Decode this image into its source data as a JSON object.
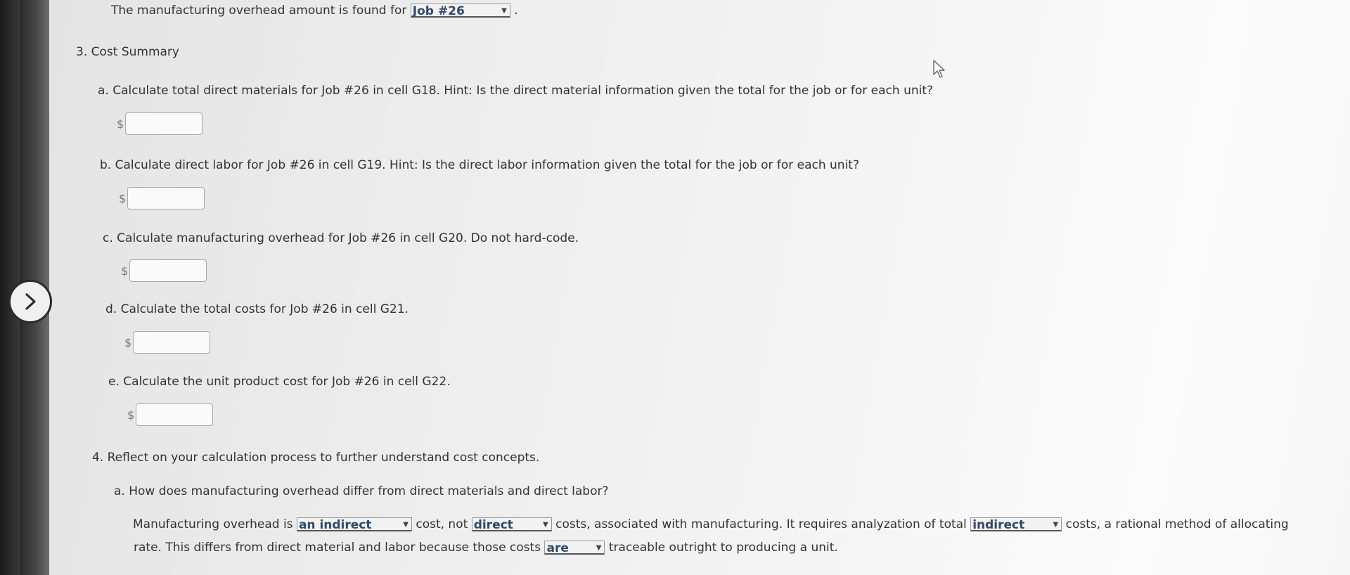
{
  "top_line": {
    "text": "The manufacturing overhead amount is found for",
    "select_value": "Job #26",
    "suffix": "."
  },
  "section3": {
    "heading": "3. Cost Summary",
    "items": [
      {
        "label": "a. Calculate total direct materials for Job #26 in cell G18. Hint: Is the direct material information given the total for the job or for each unit?",
        "currency": "$"
      },
      {
        "label": "b. Calculate direct labor for Job #26 in cell G19. Hint: Is the direct labor information given the total for the job or for each unit?",
        "currency": "$"
      },
      {
        "label": "c. Calculate manufacturing overhead for Job #26 in cell G20. Do not hard-code.",
        "currency": "$"
      },
      {
        "label": "d. Calculate the total costs for Job #26 in cell G21.",
        "currency": "$"
      },
      {
        "label": "e. Calculate the unit product cost for Job #26 in cell G22.",
        "currency": "$"
      }
    ]
  },
  "section4": {
    "heading": "4. Reflect on your calculation process to further understand cost concepts.",
    "question_a": "a. How does manufacturing overhead differ from direct materials and direct labor?",
    "answer": {
      "p1": "Manufacturing overhead is",
      "sel1": "an indirect",
      "p2": "cost, not",
      "sel2": "direct",
      "p3": "costs, associated with manufacturing. It requires analyzation of total",
      "sel3": "indirect",
      "p4": "costs, a rational method of allocating",
      "p5": "rate. This differs from direct material and labor because those costs",
      "sel4": "are",
      "p6": "traceable outright to producing a unit."
    }
  },
  "icons": {
    "nav": "chevron-right-icon",
    "pointer": "mouse-pointer-icon",
    "dropdown": "caret-down-icon"
  }
}
